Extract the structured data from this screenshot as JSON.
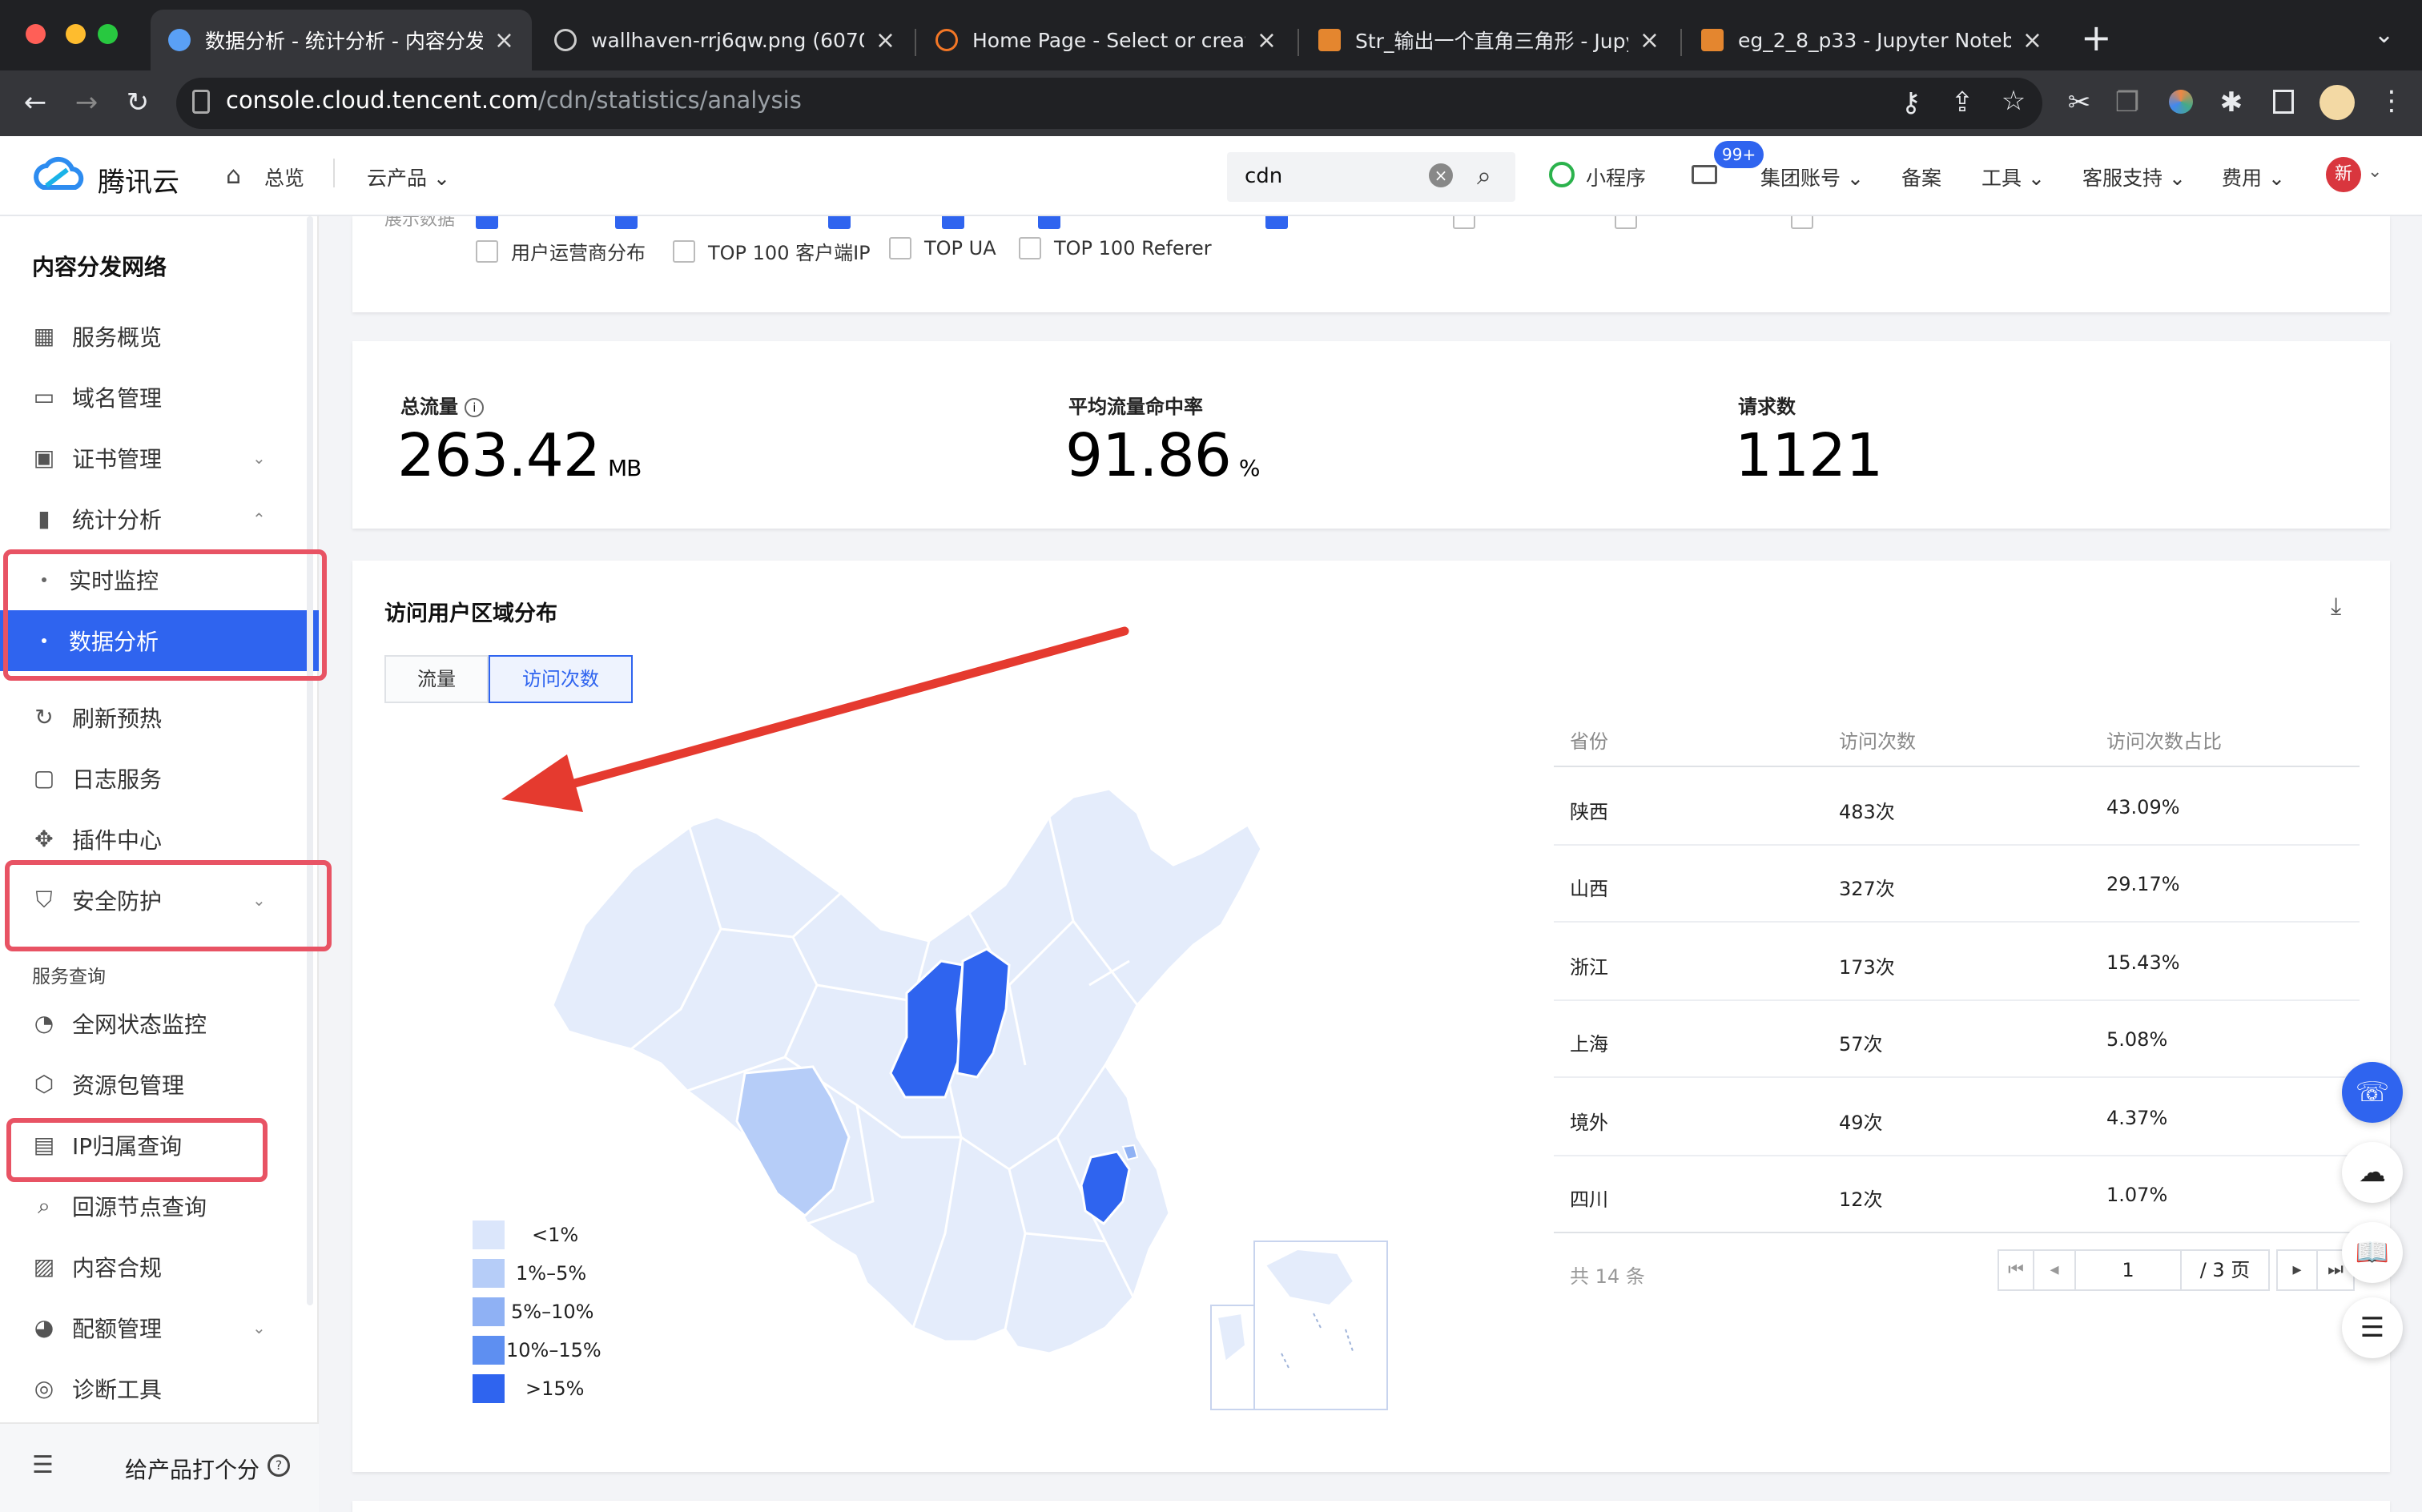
{
  "browser": {
    "tabs": [
      {
        "title": "数据分析 - 统计分析 - 内容分发",
        "active": true
      },
      {
        "title": "wallhaven-rrj6qw.png (6070×"
      },
      {
        "title": "Home Page - Select or create"
      },
      {
        "title": "Str_输出一个直角三角形 - Jupy"
      },
      {
        "title": "eg_2_8_p33 - Jupyter Notebo"
      }
    ],
    "url_host": "console.cloud.tencent.com",
    "url_path": "/cdn/statistics/analysis"
  },
  "header": {
    "brand": "腾讯云",
    "overview": "总览",
    "products": "云产品",
    "search_value": "cdn",
    "mini_program": "小程序",
    "mail_badge": "99+",
    "group_account": "集团账号",
    "filing": "备案",
    "tools": "工具",
    "support": "客服支持",
    "fees": "费用",
    "avatar_text": "新"
  },
  "sidebar": {
    "title": "内容分发网络",
    "items": [
      {
        "label": "服务概览",
        "icon": "grid-icon"
      },
      {
        "label": "域名管理",
        "icon": "domain-icon"
      },
      {
        "label": "证书管理",
        "icon": "certificate-icon",
        "expandable": true
      },
      {
        "label": "统计分析",
        "icon": "bar-chart-icon",
        "expanded": true
      },
      {
        "label": "实时监控",
        "sub": true
      },
      {
        "label": "数据分析",
        "sub": true,
        "active": true
      },
      {
        "label": "刷新预热",
        "icon": "refresh-icon"
      },
      {
        "label": "日志服务",
        "icon": "log-icon"
      },
      {
        "label": "插件中心",
        "icon": "plugin-icon"
      },
      {
        "label": "安全防护",
        "icon": "shield-icon",
        "expandable": true
      },
      {
        "label": "全网状态监控",
        "icon": "gauge-icon"
      },
      {
        "label": "资源包管理",
        "icon": "package-icon"
      },
      {
        "label": "IP归属查询",
        "icon": "ip-icon"
      },
      {
        "label": "回源节点查询",
        "icon": "search-node-icon"
      },
      {
        "label": "内容合规",
        "icon": "image-icon"
      },
      {
        "label": "配额管理",
        "icon": "pie-icon",
        "expandable": true
      },
      {
        "label": "诊断工具",
        "icon": "diagnose-icon"
      }
    ],
    "section_label": "服务查询",
    "feedback": "给产品打个分"
  },
  "filters": {
    "partial_label": "展示数据",
    "options": [
      "用户运营商分布",
      "TOP 100 客户端IP",
      "TOP UA",
      "TOP 100 Referer"
    ]
  },
  "metrics": [
    {
      "label": "总流量",
      "value": "263.42",
      "unit": "MB"
    },
    {
      "label": "平均流量命中率",
      "value": "91.86",
      "unit": "%"
    },
    {
      "label": "请求数",
      "value": "1121",
      "unit": ""
    }
  ],
  "region": {
    "title": "访问用户区域分布",
    "tabs": [
      "流量",
      "访问次数"
    ],
    "active_tab": 1,
    "legend": [
      {
        "label": "<1%",
        "color": "#dbe6fb"
      },
      {
        "label": "1%–5%",
        "color": "#b6cdf8"
      },
      {
        "label": "5%–10%",
        "color": "#8fb1f4"
      },
      {
        "label": "10%–15%",
        "color": "#5e8ff1"
      },
      {
        "label": ">15%",
        "color": "#2f64ef"
      }
    ],
    "table_headers": [
      "省份",
      "访问次数",
      "访问次数占比"
    ],
    "rows": [
      {
        "province": "陕西",
        "visits": "483次",
        "share": "43.09%"
      },
      {
        "province": "山西",
        "visits": "327次",
        "share": "29.17%"
      },
      {
        "province": "浙江",
        "visits": "173次",
        "share": "15.43%"
      },
      {
        "province": "上海",
        "visits": "57次",
        "share": "5.08%"
      },
      {
        "province": "境外",
        "visits": "49次",
        "share": "4.37%"
      },
      {
        "province": "四川",
        "visits": "12次",
        "share": "1.07%"
      }
    ],
    "total_text": "共 14 条",
    "page_current": "1",
    "page_total": "/ 3 页"
  },
  "colors": {
    "accent": "#2f64ef",
    "highlight_box": "#e85364",
    "arrow": "#e53a2f",
    "map_base": "#e4ecfb"
  }
}
